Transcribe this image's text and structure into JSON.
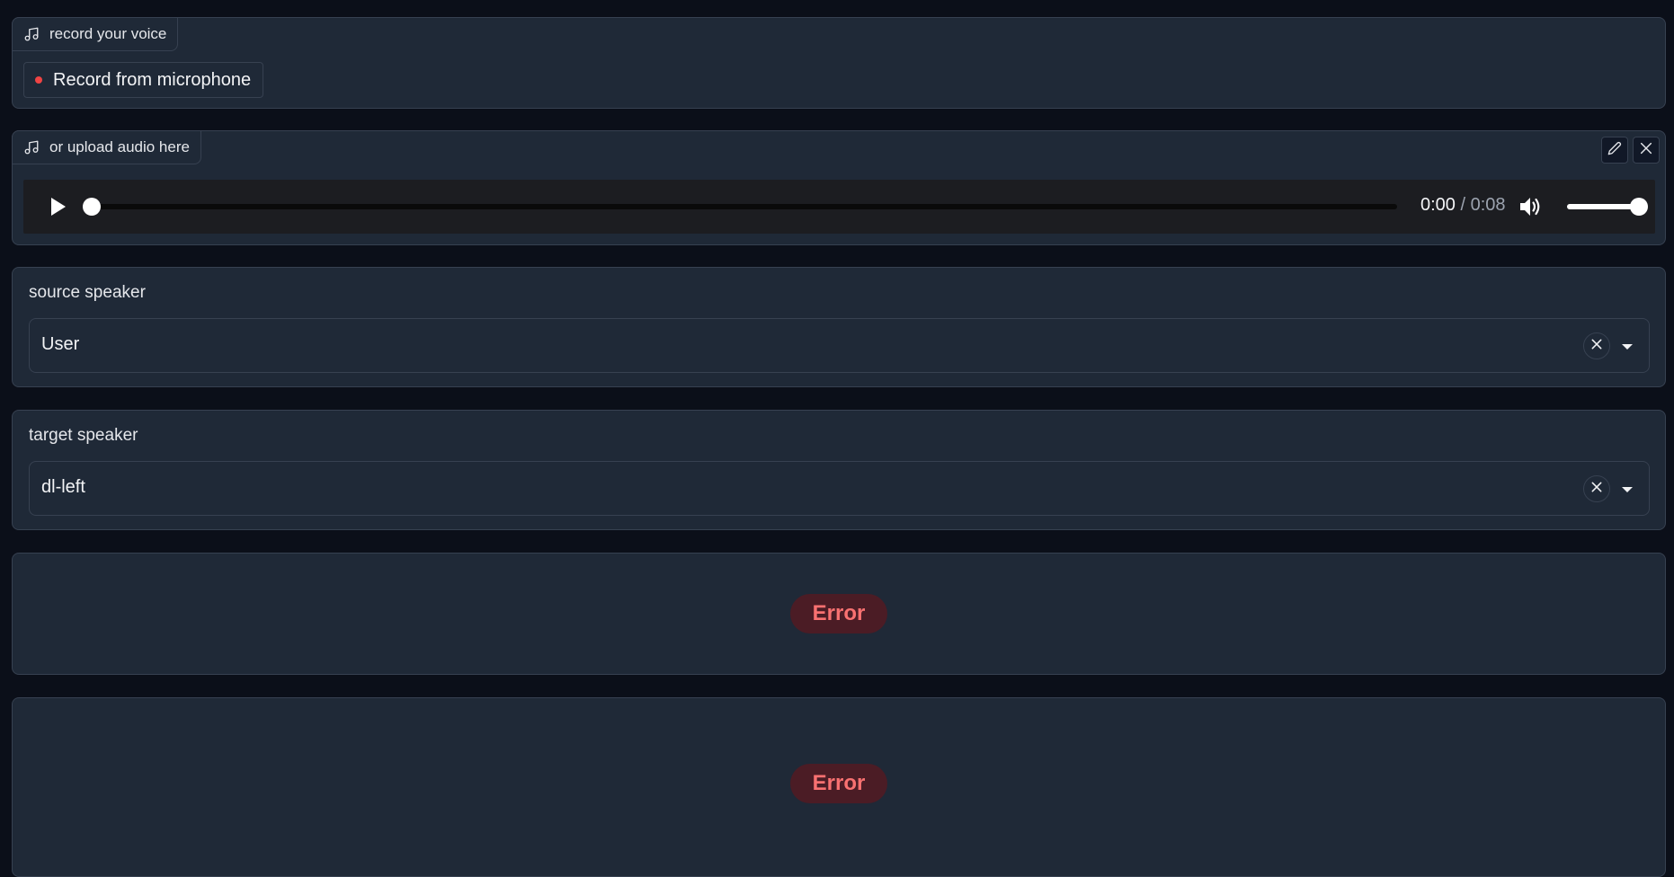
{
  "record_panel": {
    "label": "record your voice",
    "label_icon": "music-note-icon",
    "record_button": "Record from microphone"
  },
  "upload_panel": {
    "label": "or upload audio here",
    "label_icon": "music-note-icon",
    "edit_icon": "pencil-icon",
    "close_icon": "close-icon",
    "player": {
      "current_time": "0:00",
      "separator": "/",
      "duration": "0:08",
      "progress": 0,
      "volume": 1.0
    }
  },
  "source_speaker": {
    "label": "source speaker",
    "value": "User"
  },
  "target_speaker": {
    "label": "target speaker",
    "value": "dl-left"
  },
  "output_1": {
    "status": "Error"
  },
  "output_2": {
    "status": "Error"
  },
  "colors": {
    "background": "#0b0f19",
    "panel": "#1f2937",
    "border": "#374151",
    "record_dot": "#ef4444",
    "error_text": "#f87171",
    "error_bg": "#4b1c25"
  }
}
